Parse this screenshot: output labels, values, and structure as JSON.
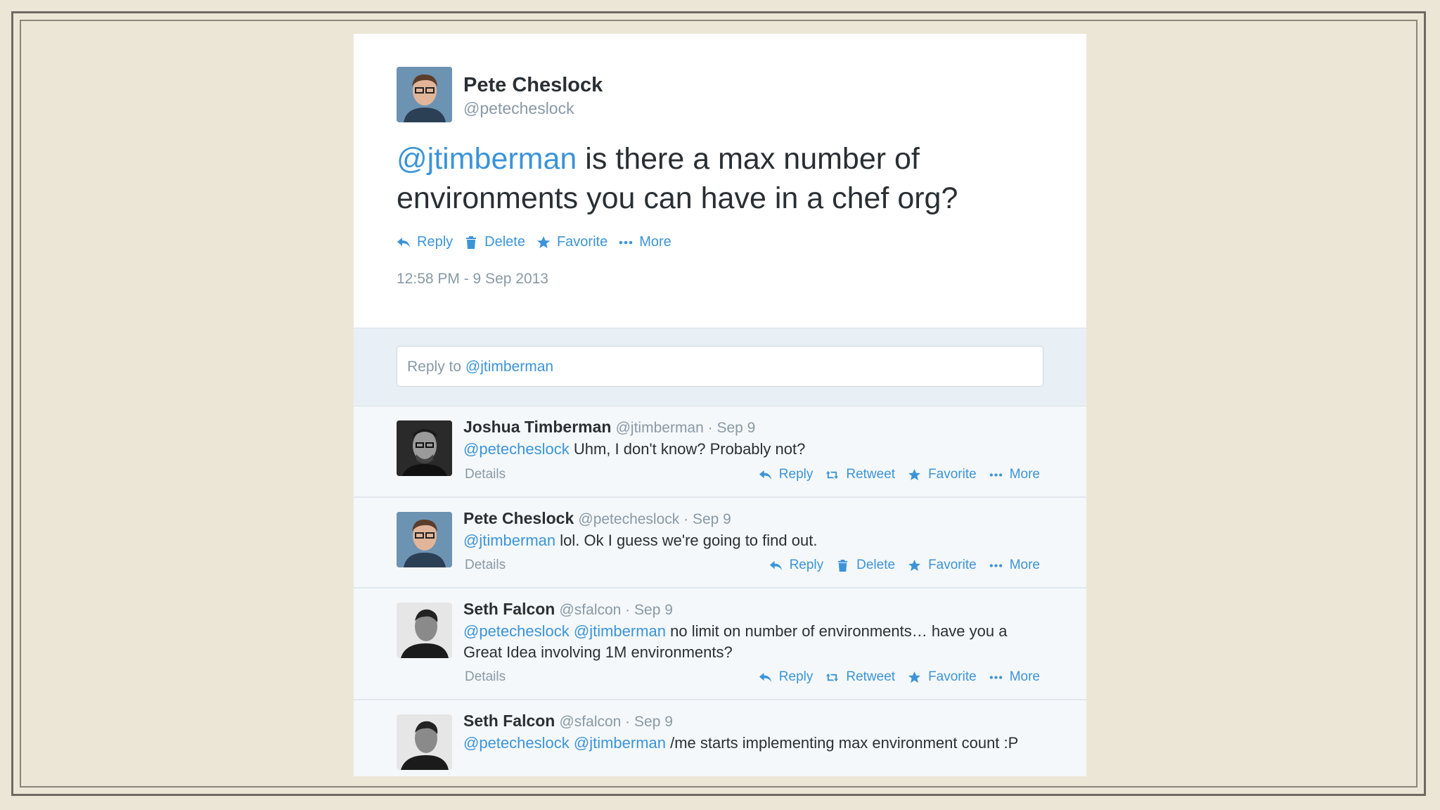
{
  "main": {
    "name": "Pete Cheslock",
    "handle": "@petecheslock",
    "text_mention": "@jtimberman",
    "text_body": " is there a max number of environments you can have in a chef org?",
    "actions": [
      "Reply",
      "Delete",
      "Favorite",
      "More"
    ],
    "timestamp": "12:58 PM - 9 Sep 2013"
  },
  "reply_box": {
    "prefix": "Reply to ",
    "mention": "@jtimberman"
  },
  "replies": [
    {
      "name": "Joshua Timberman",
      "handle": "@jtimberman",
      "date": " · Sep 9",
      "mentions": "@petecheslock",
      "text": " Uhm, I don't know? Probably not?",
      "details": "Details",
      "actions": [
        "Reply",
        "Retweet",
        "Favorite",
        "More"
      ]
    },
    {
      "name": "Pete Cheslock",
      "handle": "@petecheslock",
      "date": " · Sep 9",
      "mentions": "@jtimberman",
      "text": " lol. Ok I guess we're going to find out.",
      "details": "Details",
      "actions": [
        "Reply",
        "Delete",
        "Favorite",
        "More"
      ]
    },
    {
      "name": "Seth Falcon",
      "handle": "@sfalcon",
      "date": " · Sep 9",
      "mentions": "@petecheslock @jtimberman",
      "text": " no limit on number of environments… have you a Great Idea involving 1M environments?",
      "details": "Details",
      "actions": [
        "Reply",
        "Retweet",
        "Favorite",
        "More"
      ]
    },
    {
      "name": "Seth Falcon",
      "handle": "@sfalcon",
      "date": " · Sep 9",
      "mentions": "@petecheslock @jtimberman",
      "text": " /me starts implementing max environment count :P"
    }
  ],
  "colors": {
    "link": "#3b94d9",
    "text": "#292f33",
    "muted": "#8899a6",
    "reply_bg": "#f5f8fa",
    "compose_bg": "#e8f0f5",
    "slide_bg": "#ece6d7"
  },
  "icons": [
    "reply-icon",
    "trash-icon",
    "star-icon",
    "more-dots-icon",
    "retweet-icon"
  ]
}
